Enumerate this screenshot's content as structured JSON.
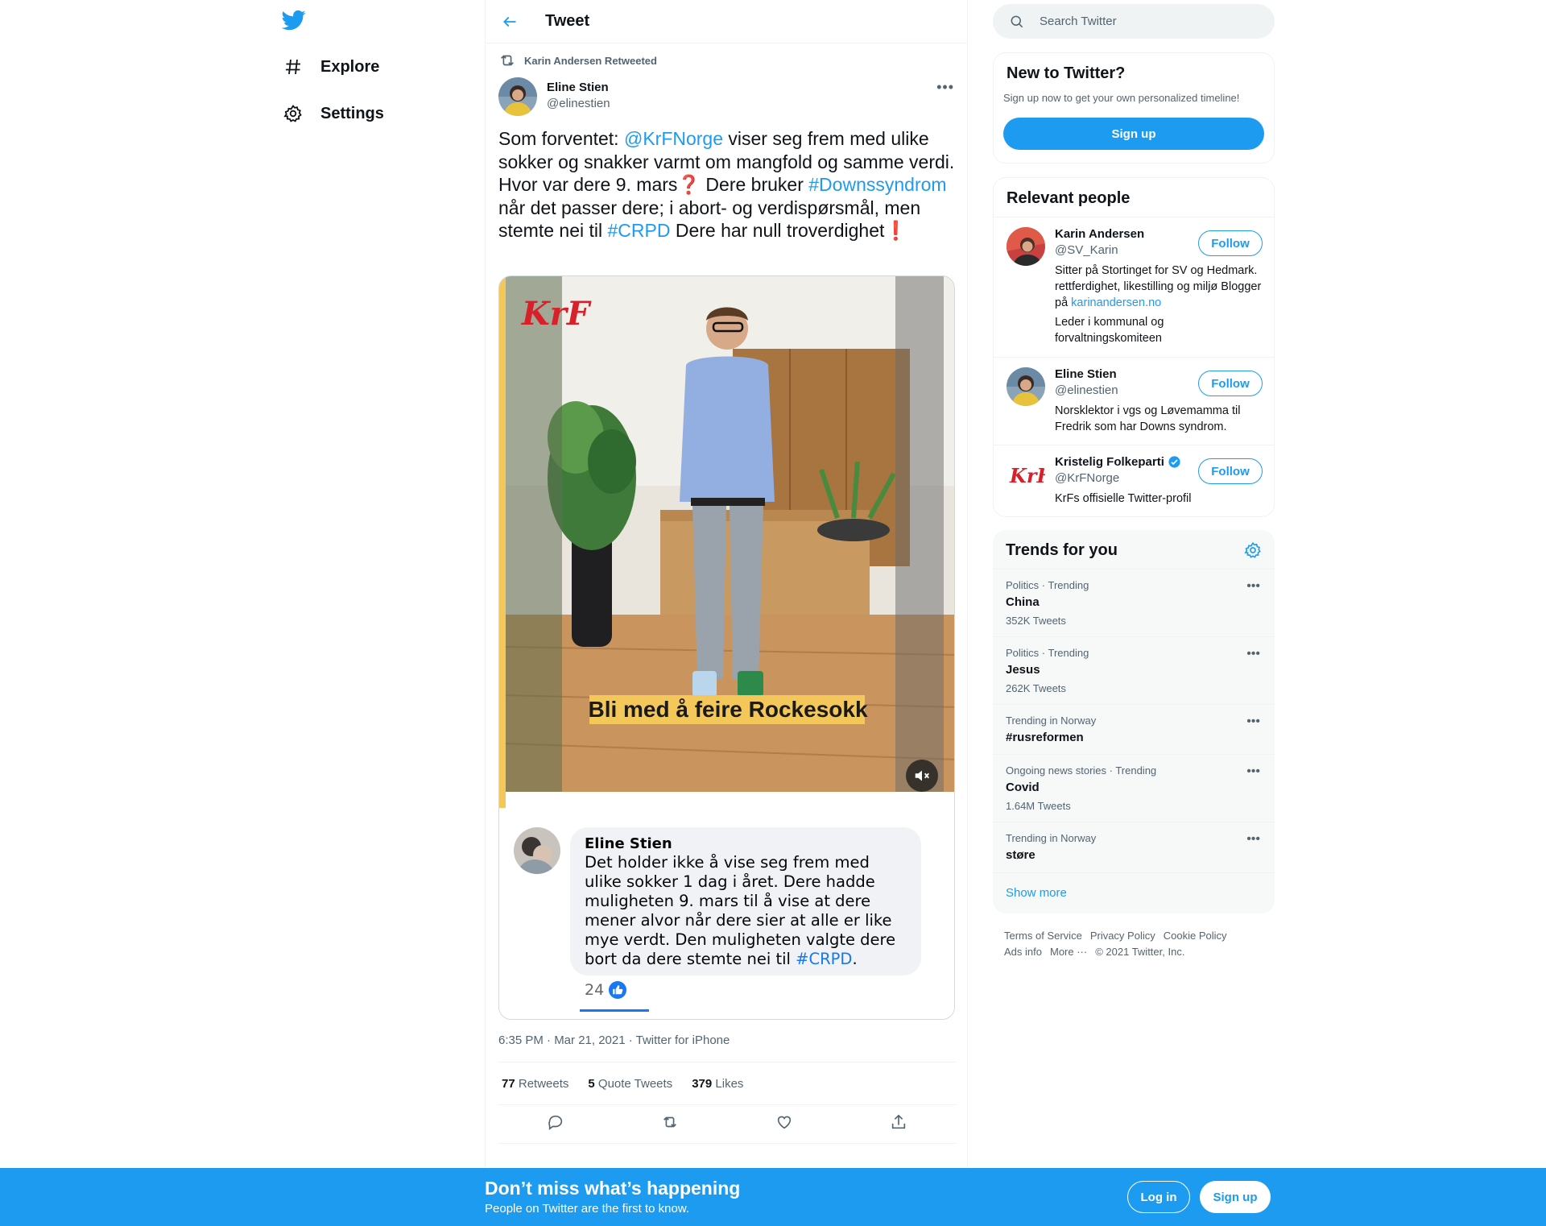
{
  "nav": {
    "items": [
      {
        "label": "Explore",
        "icon": "hashtag-icon"
      },
      {
        "label": "Settings",
        "icon": "gear-icon"
      }
    ]
  },
  "header": {
    "title": "Tweet"
  },
  "tweet": {
    "retweeted_by": "Karin Andersen Retweeted",
    "author_name": "Eline Stien",
    "author_handle": "@elinestien",
    "text_segments": [
      {
        "text": "Som forventet: ",
        "type": "text"
      },
      {
        "text": "@KrFNorge",
        "type": "link"
      },
      {
        "text": " viser seg frem med ulike sokker og snakker varmt om mangfold og samme verdi. Hvor var dere 9. mars",
        "type": "text"
      },
      {
        "text": "❓",
        "type": "red"
      },
      {
        "text": " Dere bruker ",
        "type": "text"
      },
      {
        "text": "#Downssyndrom",
        "type": "link"
      },
      {
        "text": " når det passer dere; i abort- og verdispørsmål, men stemte nei til ",
        "type": "text"
      },
      {
        "text": "#CRPD",
        "type": "link"
      },
      {
        "text": " Dere har null troverdighet",
        "type": "text"
      },
      {
        "text": "❗",
        "type": "red"
      }
    ],
    "media": {
      "logo_text": "KrF",
      "caption": "Bli med å feire Rockesokk",
      "comment_author": "Eline Stien",
      "comment_text": "Det holder ikke å vise seg frem med ulike sokker 1 dag i året. Dere hadde muligheten 9. mars til å vise at dere mener alvor når dere sier at alle er like mye verdt. Den muligheten valgte dere bort da dere stemte nei til ",
      "comment_link": "#CRPD",
      "comment_end": ".",
      "comment_likes": "24"
    },
    "timestamp": "6:35 PM · Mar 21, 2021 · Twitter for iPhone",
    "stats": {
      "retweets_count": "77",
      "retweets_label": "Retweets",
      "quotes_count": "5",
      "quotes_label": "Quote Tweets",
      "likes_count": "379",
      "likes_label": "Likes"
    }
  },
  "search": {
    "placeholder": "Search Twitter"
  },
  "new_to_twitter": {
    "title": "New to Twitter?",
    "subtitle": "Sign up now to get your own personalized timeline!",
    "button": "Sign up"
  },
  "relevant_people": {
    "title": "Relevant people",
    "people": [
      {
        "name": "Karin Andersen",
        "handle": "@SV_Karin",
        "bio": "Sitter på Stortinget for SV og Hedmark. rettferdighet, likestilling og miljø Blogger på ",
        "bio_link": "karinandersen.no",
        "bio2": "Leder i kommunal og forvaltningskomiteen",
        "follow": "Follow"
      },
      {
        "name": "Eline Stien",
        "handle": "@elinestien",
        "bio": "Norsklektor i vgs og Løvemamma til Fredrik som har Downs syndrom.",
        "follow": "Follow"
      },
      {
        "name": "Kristelig Folkeparti",
        "handle": "@KrFNorge",
        "bio": "KrFs offisielle Twitter-profil",
        "follow": "Follow",
        "verified": true
      }
    ]
  },
  "trends": {
    "title": "Trends for you",
    "items": [
      {
        "meta": "Politics · Trending",
        "name": "China",
        "count": "352K Tweets"
      },
      {
        "meta": "Politics · Trending",
        "name": "Jesus",
        "count": "262K Tweets"
      },
      {
        "meta": "Trending in Norway",
        "name": "#rusreformen",
        "count": ""
      },
      {
        "meta": "Ongoing news stories · Trending",
        "name": "Covid",
        "count": "1.64M Tweets"
      },
      {
        "meta": "Trending in Norway",
        "name": "støre",
        "count": ""
      }
    ],
    "show_more": "Show more"
  },
  "footer": {
    "terms": "Terms of Service",
    "privacy": "Privacy Policy",
    "cookie": "Cookie Policy",
    "ads": "Ads info",
    "more": "More ···",
    "copyright": "© 2021 Twitter, Inc."
  },
  "bottom_bar": {
    "title": "Don’t miss what’s happening",
    "subtitle": "People on Twitter are the first to know.",
    "login": "Log in",
    "signup": "Sign up"
  },
  "colors": {
    "accent": "#1d9bf0",
    "text": "#0f1419",
    "muted": "#536471"
  }
}
